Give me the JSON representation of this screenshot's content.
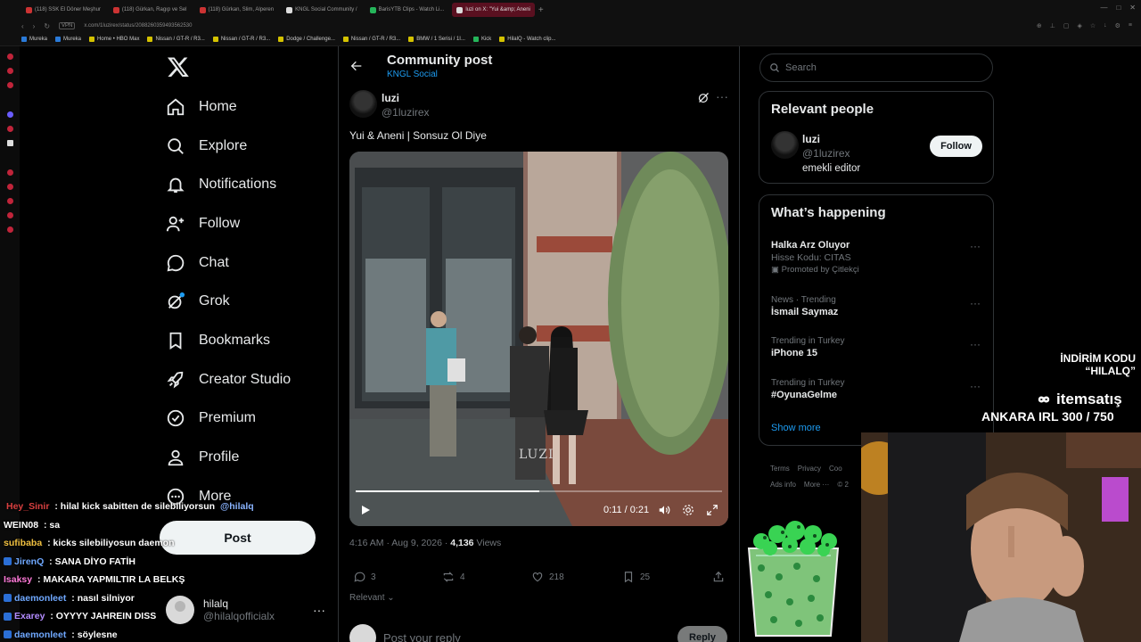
{
  "browser": {
    "tabs": [
      {
        "label": "(118) SSK El Döner Meşhur",
        "active": false
      },
      {
        "label": "(118) Gürkan, Ragıp ve Sel",
        "active": false
      },
      {
        "label": "(118) Gürkan, Slim, Alperen",
        "active": false
      },
      {
        "label": "KNGL Social Community /",
        "active": false
      },
      {
        "label": "BarisYTB Clips - Watch Li...",
        "active": false
      },
      {
        "label": "luzi on X: \"Yui &amp; Aneni",
        "active": true
      }
    ],
    "vpn_label": "VPN",
    "url": "x.com/1luzirex/status/2088260359493562530",
    "bookmarks": [
      "Mureka",
      "Mureka",
      "Home • HBO Max",
      "Nissan / GT-R / R3...",
      "Nissan / GT-R / R3...",
      "Dodge / Challenge...",
      "Nissan / GT-R / R3...",
      "BMW / 1 Serisi / 1I...",
      "Kick",
      "HilalQ - Watch clip..."
    ]
  },
  "sidebar": {
    "items": [
      {
        "label": "Home",
        "icon": "home-icon"
      },
      {
        "label": "Explore",
        "icon": "search-icon"
      },
      {
        "label": "Notifications",
        "icon": "bell-icon"
      },
      {
        "label": "Follow",
        "icon": "person-add-icon"
      },
      {
        "label": "Chat",
        "icon": "chat-icon"
      },
      {
        "label": "Grok",
        "icon": "grok-icon"
      },
      {
        "label": "Bookmarks",
        "icon": "bookmark-icon"
      },
      {
        "label": "Creator Studio",
        "icon": "rocket-icon"
      },
      {
        "label": "Premium",
        "icon": "verified-icon"
      },
      {
        "label": "Profile",
        "icon": "person-icon"
      },
      {
        "label": "More",
        "icon": "more-circle-icon"
      }
    ],
    "post_label": "Post",
    "account": {
      "name": "hilalq",
      "handle": "@hilalqofficialx",
      "more": "···"
    }
  },
  "chat": [
    {
      "user": "Hey_Sinir",
      "text": " : hilal kick sabitten de silebiliyorsun ",
      "mention": "@hilalq",
      "color": "#d94040"
    },
    {
      "user": "WEIN08",
      "text": " : sa",
      "mention": "",
      "color": "#ffffff"
    },
    {
      "user": "sufibaba",
      "text": " : kicks silebiliyosun daemon",
      "mention": "",
      "color": "#f0c040"
    },
    {
      "user": "JirenQ",
      "text": " : SANA DİYO FATİH",
      "mention": "",
      "color": "#6fa8ff"
    },
    {
      "user": "Isaksy",
      "text": " : MAKARA YAPMILTIR LA BELKŞ",
      "mention": "",
      "color": "#ff7ad9"
    },
    {
      "user": "daemonleet",
      "text": " : nasıl silniyor",
      "mention": "",
      "color": "#6fa8ff"
    },
    {
      "user": "Exarey",
      "text": " : OYYYY JAHREIN DISS",
      "mention": "",
      "color": "#b38cff"
    },
    {
      "user": "daemonleet",
      "text": " : söylesne",
      "mention": "",
      "color": "#6fa8ff"
    }
  ],
  "main": {
    "header_title": "Community post",
    "header_sub": "KNGL Social",
    "tweet": {
      "name": "luzi",
      "handle": "@1luzirex",
      "text": "Yui & Aneni | Sonsuz Ol Diye",
      "video": {
        "watermark": "LUZI",
        "time": "0:11 / 0:21",
        "progress": 0.5
      },
      "meta_time": "4:16 AM · Aug 9, 2026 · ",
      "views": "4,136",
      "views_label": " Views",
      "replies": "3",
      "reposts": "4",
      "likes": "218",
      "bookmarks": "25"
    },
    "sort_label": "Relevant",
    "reply_placeholder": "Post your reply",
    "reply_button": "Reply"
  },
  "right": {
    "search_placeholder": "Search",
    "relevant_title": "Relevant people",
    "person": {
      "name": "luzi",
      "handle": "@1luzirex",
      "bio": "emekli editor",
      "follow": "Follow"
    },
    "happening_title": "What’s happening",
    "trends": [
      {
        "context": "",
        "title": "Halka Arz Oluyor",
        "sub": "Hisse Kodu: CITAS",
        "promo": "Promoted by Çitlekçi"
      },
      {
        "context": "News · Trending",
        "title": "İsmail Saymaz",
        "sub": "",
        "promo": ""
      },
      {
        "context": "Trending in Turkey",
        "title": "iPhone 15",
        "sub": "",
        "promo": ""
      },
      {
        "context": "Trending in Turkey",
        "title": "#OyunaGelme",
        "sub": "",
        "promo": ""
      }
    ],
    "show_more": "Show more",
    "footer": [
      "Terms",
      "Privacy",
      "Coo",
      "Ads info",
      "More ···",
      "© 2"
    ]
  },
  "overlay": {
    "promo_l1": "İNDİRİM KODU",
    "promo_l2": "“HILALQ”",
    "brand": "itemsatış",
    "ankara": "ANKARA IRL 300 / 750"
  },
  "colors": {
    "accent": "#1d9bf0",
    "background": "#000000",
    "border": "#2f3336",
    "muted": "#71767b"
  }
}
